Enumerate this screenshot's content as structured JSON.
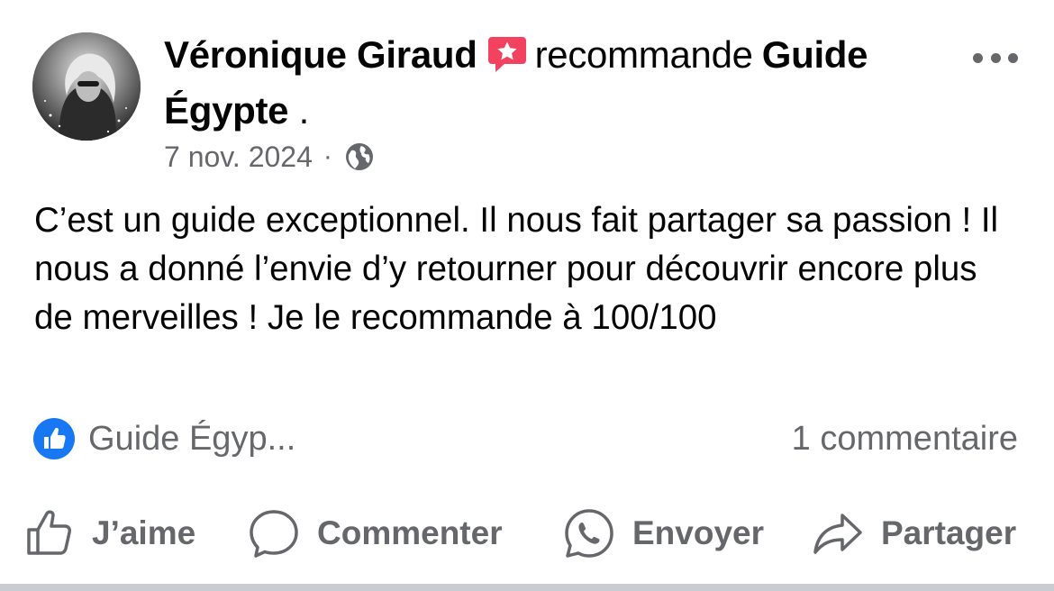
{
  "post": {
    "author": "Véronique Giraud",
    "verb": "recommande",
    "page_name": "Guide Égypte",
    "page_suffix": " .",
    "date": "7 nov. 2024",
    "separator": "·",
    "audience_icon": "globe-icon",
    "recommend_icon": "recommend-star-icon",
    "more_icon": "more-dots-icon",
    "text": "C’est un guide exceptionnel. Il nous fait partager sa passion ! Il nous a donné l’envie d’y retourner pour découvrir encore plus de merveilles ! Je le recommande à 100/100"
  },
  "reactions": {
    "icon": "like-badge-icon",
    "names": "Guide Égyp...",
    "comments": "1 commentaire"
  },
  "actions": {
    "like": {
      "label": "J’aime",
      "icon": "thumbs-up-icon"
    },
    "comment": {
      "label": "Commenter",
      "icon": "comment-bubble-icon"
    },
    "send": {
      "label": "Envoyer",
      "icon": "whatsapp-icon"
    },
    "share": {
      "label": "Partager",
      "icon": "share-arrow-icon"
    }
  },
  "colors": {
    "text_primary": "#050505",
    "text_secondary": "#65676b",
    "like_blue": "#1877f2",
    "recommend_red": "#f3425f",
    "divider": "#c9ccd1"
  }
}
